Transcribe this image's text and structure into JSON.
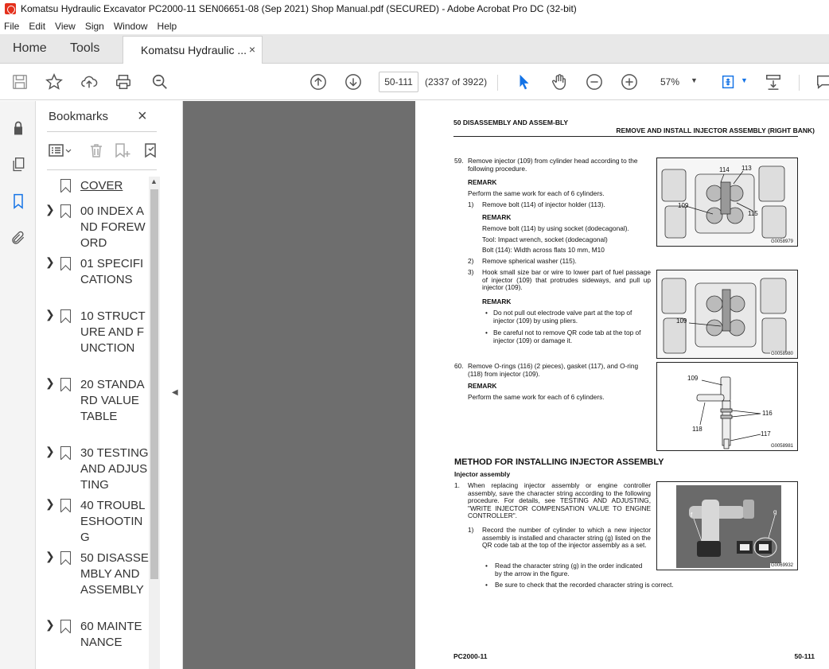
{
  "window": {
    "title": "Komatsu Hydraulic Excavator PC2000-11 SEN06651-08 (Sep 2021) Shop Manual.pdf (SECURED) - Adobe Acrobat Pro DC (32-bit)"
  },
  "menu": [
    "File",
    "Edit",
    "View",
    "Sign",
    "Window",
    "Help"
  ],
  "tabs": {
    "home": "Home",
    "tools": "Tools",
    "document": "Komatsu Hydraulic ...",
    "close": "×"
  },
  "toolbar": {
    "page_input": "50-111",
    "page_count": "(2337 of 3922)",
    "zoom": "57%"
  },
  "bookmarks": {
    "title": "Bookmarks",
    "close": "×",
    "items": [
      {
        "label": "COVER",
        "expandable": false
      },
      {
        "label": "00 INDEX AND FOREWORD",
        "expandable": true
      },
      {
        "label": "01 SPECIFICATIONS",
        "expandable": true
      },
      {
        "label": "10 STRUCTURE AND FUNCTION",
        "expandable": true
      },
      {
        "label": "20 STANDARD VALUE TABLE",
        "expandable": true
      },
      {
        "label": "30 TESTING AND ADJUSTING",
        "expandable": true
      },
      {
        "label": "40 TROUBLESHOOTING",
        "expandable": true
      },
      {
        "label": "50 DISASSEMBLY AND ASSEMBLY",
        "expandable": true
      },
      {
        "label": "60 MAINTENANCE",
        "expandable": true
      }
    ]
  },
  "doc": {
    "header_left": "50 DISASSEMBLY AND ASSEM-BLY",
    "header_right": "REMOVE AND INSTALL INJECTOR ASSEMBLY (RIGHT BANK)",
    "step59": "59.",
    "step59_text": "Remove injector (109) from cylinder head according to the following procedure.",
    "remark": "REMARK",
    "remark_same": "Perform the same work for each of 6 cylinders.",
    "s1_num": "1)",
    "s1_text": "Remove bolt (114) of injector holder (113).",
    "s1_remark1": "Remove bolt (114) by using socket (dodecagonal).",
    "s1_remark2": "Tool: Impact wrench, socket (dodecagonal)",
    "s1_remark3": "Bolt (114): Width across flats 10 mm, M10",
    "s2_num": "2)",
    "s2_text": "Remove spherical washer (115).",
    "s3_num": "3)",
    "s3_text": "Hook small size bar or wire to lower part of fuel passage of injector (109) that protrudes sideways, and pull up injector (109).",
    "s3_b1": "Do not pull out electrode valve part at the top of injector (109) by using pliers.",
    "s3_b2": "Be careful not to remove QR code tab at the top of injector (109) or damage it.",
    "step60": "60.",
    "step60_text": "Remove O-rings (116) (2 pieces), gasket (117), and O-ring (118) from injector (109).",
    "section": "METHOD FOR INSTALLING INJECTOR ASSEMBLY",
    "sub": "Injector assembly",
    "i1_num": "1.",
    "i1_text": "When replacing injector assembly or engine controller assembly, save the character string according to the following procedure. For details, see TESTING AND ADJUSTING, \"WRITE INJECTOR COMPENSATION VALUE TO ENGINE CONTROLLER\".",
    "i1a_num": "1)",
    "i1a_text": "Record the number of cylinder to which a new injector assembly is installed and character string (g) listed on the QR code tab at the top of the injector assembly as a set.",
    "i1a_b1": "Read the character string (g) in the order indicated by the arrow in the figure.",
    "i1a_b2": "Be sure to check that the recorded character string is correct.",
    "bullet": "•",
    "fig1_code": "G0058979",
    "fig1_labels": [
      "114",
      "113",
      "109",
      "115"
    ],
    "fig2_code": "G0058980",
    "fig2_labels": [
      "109"
    ],
    "fig3_code": "G0058981",
    "fig3_labels": [
      "109",
      "116",
      "118",
      "117"
    ],
    "fig4_code": "G0069932",
    "fig4_labels": [
      "f",
      "g"
    ],
    "footer_left": "PC2000-11",
    "footer_right": "50-111"
  },
  "colors": {
    "accent_blue": "#1473e6",
    "acrobat_red": "#e4311d",
    "doc_bg": "#6e6e6e"
  }
}
